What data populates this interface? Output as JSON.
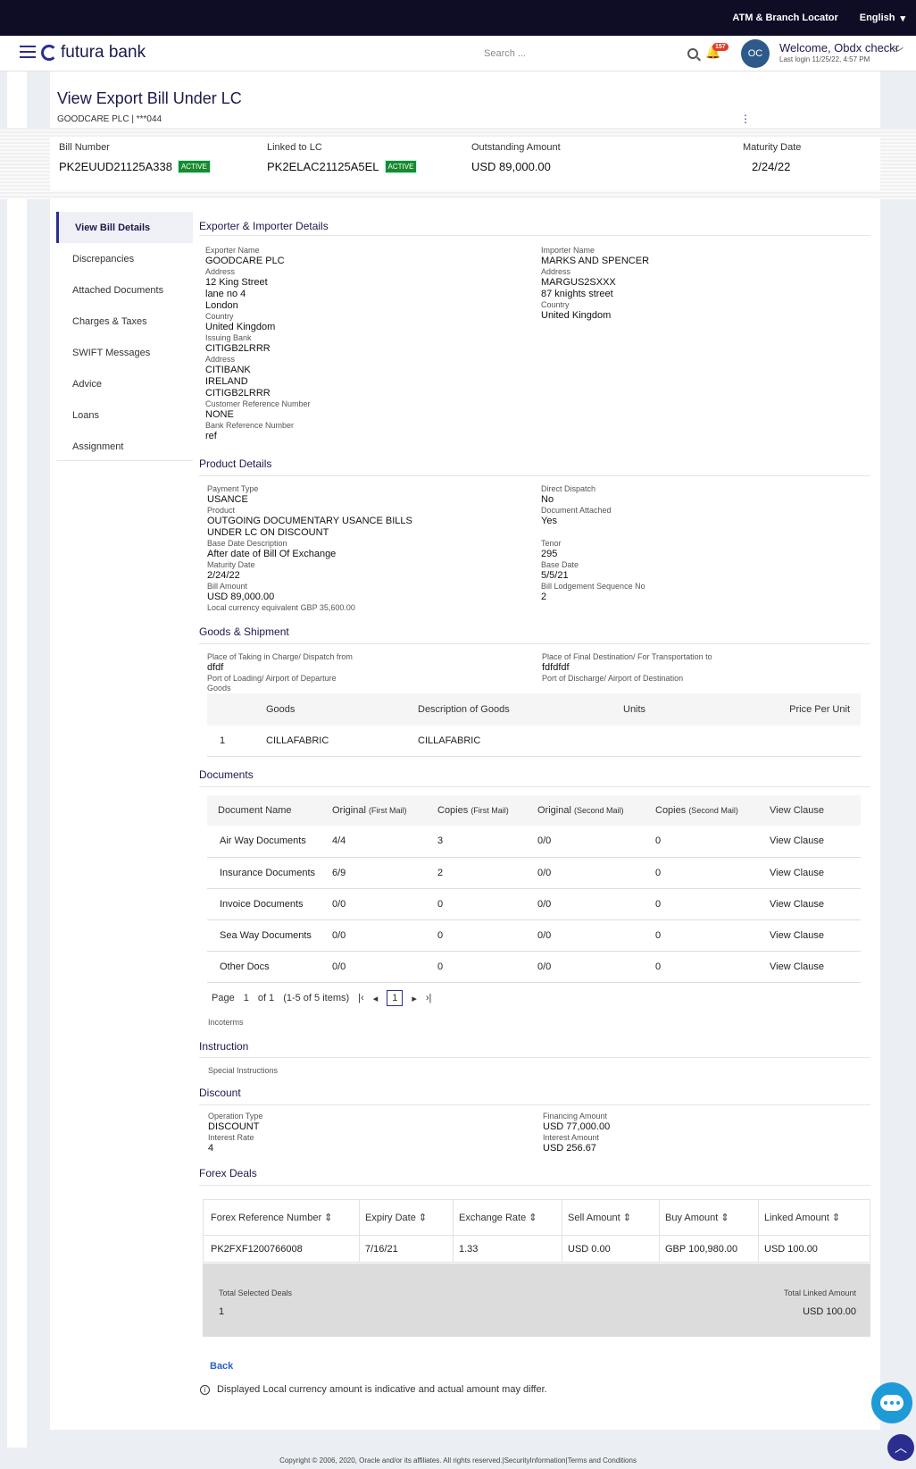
{
  "topbar": {
    "atm": "ATM & Branch Locator",
    "language": "English"
  },
  "header": {
    "brand": "futura bank",
    "search_placeholder": "Search ...",
    "notif_count": "157",
    "avatar_initials": "OC",
    "welcome": "Welcome, Obdx checkr",
    "last_login": "Last login 11/25/22, 4:57 PM"
  },
  "page": {
    "title": "View Export Bill Under LC",
    "subtitle": "GOODCARE PLC | ***044"
  },
  "summary": {
    "bill_number_label": "Bill Number",
    "bill_number": "PK2EUUD21125A338",
    "bill_status": "ACTIVE",
    "linked_lc_label": "Linked to LC",
    "linked_lc": "PK2ELAC21125A5EL",
    "lc_status": "ACTIVE",
    "outstanding_label": "Outstanding Amount",
    "outstanding": "USD 89,000.00",
    "maturity_label": "Maturity Date",
    "maturity": "2/24/22"
  },
  "tabs": [
    "View Bill Details",
    "Discrepancies",
    "Attached Documents",
    "Charges & Taxes",
    "SWIFT Messages",
    "Advice",
    "Loans",
    "Assignment"
  ],
  "exporter_section": {
    "title": "Exporter & Importer Details",
    "left": [
      {
        "label": "Exporter Name",
        "values": [
          "GOODCARE PLC"
        ]
      },
      {
        "label": "Address",
        "values": [
          "12 King Street",
          "lane no 4",
          "London"
        ]
      },
      {
        "label": "Country",
        "values": [
          "United Kingdom"
        ]
      },
      {
        "label": "Issuing Bank",
        "values": [
          "CITIGB2LRRR"
        ]
      },
      {
        "label": "Address",
        "values": [
          "CITIBANK",
          "IRELAND",
          "CITIGB2LRRR"
        ]
      },
      {
        "label": "Customer Reference Number",
        "values": [
          "NONE"
        ]
      },
      {
        "label": "Bank Reference Number",
        "values": [
          "ref"
        ]
      }
    ],
    "right": [
      {
        "label": "Importer Name",
        "values": [
          "MARKS AND SPENCER"
        ]
      },
      {
        "label": "Address",
        "values": [
          "MARGUS2SXXX",
          "87 knights street"
        ]
      },
      {
        "label": "Country",
        "values": [
          "United Kingdom"
        ]
      }
    ]
  },
  "product_section": {
    "title": "Product Details",
    "payment_type_label": "Payment Type",
    "payment_type": "USANCE",
    "product_label": "Product",
    "product_1": "OUTGOING DOCUMENTARY USANCE BILLS",
    "product_2": "UNDER LC ON DISCOUNT",
    "base_desc_label": "Base Date Description",
    "base_desc": "After date of Bill Of Exchange",
    "maturity_label": "Maturity Date",
    "maturity": "2/24/22",
    "bill_amount_label": "Bill Amount",
    "bill_amount": "USD 89,000.00",
    "local_equiv": "Local currency equivalent GBP 35,600.00",
    "direct_dispatch_label": "Direct Dispatch",
    "direct_dispatch": "No",
    "doc_attached_label": "Document Attached",
    "doc_attached": "Yes",
    "tenor_label": "Tenor",
    "tenor": "295",
    "base_date_label": "Base Date",
    "base_date": "5/5/21",
    "lodgement_label": "Bill Lodgement Sequence No",
    "lodgement": "2"
  },
  "goods_section": {
    "title": "Goods & Shipment",
    "taking_label": "Place of Taking in Charge/ Dispatch from",
    "taking": "dfdf",
    "loading_label": "Port of Loading/ Airport of Departure",
    "goods_label": "Goods",
    "final_label": "Place of Final Destination/ For Transportation to",
    "final": "fdfdfdf",
    "discharge_label": "Port of Discharge/ Airport of Destination",
    "columns": [
      "Goods",
      "Description of Goods",
      "Units",
      "Price Per Unit"
    ],
    "rows": [
      [
        "1",
        "CILLAFABRIC",
        "CILLAFABRIC",
        "",
        ""
      ]
    ]
  },
  "documents_section": {
    "title": "Documents",
    "columns": [
      "Document Name",
      "Original",
      "(First Mail)",
      "Copies",
      "(First Mail)",
      "Original",
      "(Second Mail)",
      "Copies",
      "(Second Mail)",
      "View Clause"
    ],
    "rows": [
      [
        "Air Way Documents",
        "4/4",
        "3",
        "0/0",
        "0",
        "View Clause"
      ],
      [
        "Insurance Documents",
        "6/9",
        "2",
        "0/0",
        "0",
        "View Clause"
      ],
      [
        "Invoice Documents",
        "0/0",
        "0",
        "0/0",
        "0",
        "View Clause"
      ],
      [
        "Sea Way Documents",
        "0/0",
        "0",
        "0/0",
        "0",
        "View Clause"
      ],
      [
        "Other Docs",
        "0/0",
        "0",
        "0/0",
        "0",
        "View Clause"
      ]
    ],
    "pager": {
      "page_label": "Page",
      "page": "1",
      "of": "of 1",
      "items": "(1-5 of 5 items)",
      "current": "1"
    },
    "incoterms_label": "Incoterms"
  },
  "instruction_section": {
    "title": "Instruction",
    "special_label": "Special Instructions"
  },
  "discount_section": {
    "title": "Discount",
    "op_type_label": "Operation Type",
    "op_type": "DISCOUNT",
    "rate_label": "Interest Rate",
    "rate": "4",
    "fin_label": "Financing Amount",
    "fin": "USD 77,000.00",
    "int_label": "Interest Amount",
    "int": "USD 256.67"
  },
  "forex_section": {
    "title": "Forex Deals",
    "columns": [
      "Forex Reference Number",
      "Expiry Date",
      "Exchange Rate",
      "Sell Amount",
      "Buy Amount",
      "Linked Amount"
    ],
    "rows": [
      [
        "PK2FXF1200766008",
        "7/16/21",
        "1.33",
        "USD 0.00",
        "GBP 100,980.00",
        "USD 100.00"
      ]
    ],
    "total_deals_label": "Total Selected Deals",
    "total_deals": "1",
    "total_linked_label": "Total Linked Amount",
    "total_linked": "USD 100.00"
  },
  "back_label": "Back",
  "note": "Displayed Local currency amount is indicative and actual amount may differ.",
  "footer": "Copyright © 2006, 2020, Oracle and/or its affiliates. All rights reserved.|SecurityInformation|Terms and Conditions",
  "colors": {
    "accent": "#2b2e8f",
    "topbar": "#0f0c26",
    "active_badge": "#1a8a2e",
    "link": "#2b62c8"
  }
}
